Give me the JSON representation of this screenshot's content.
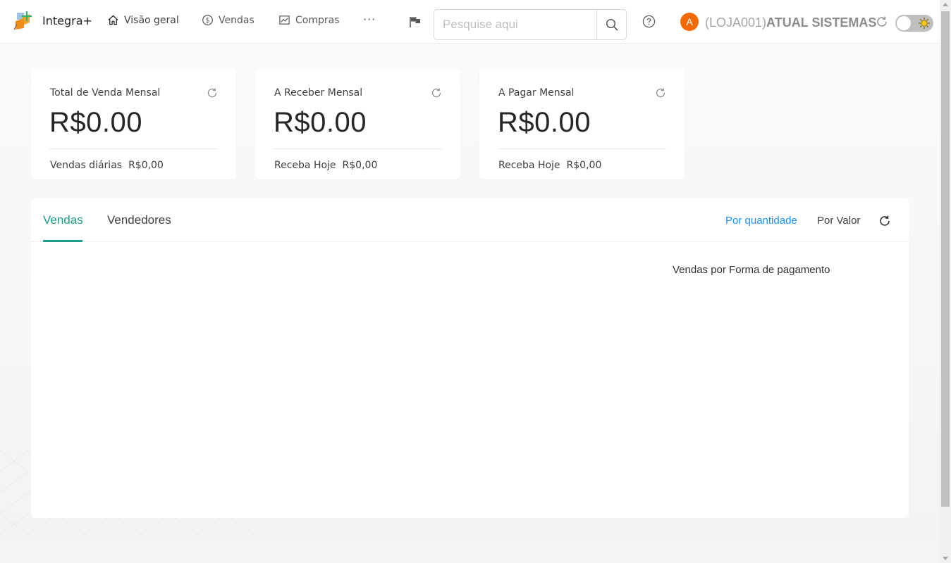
{
  "header": {
    "brand": "Integra+",
    "nav": [
      {
        "label": "Visão geral",
        "icon": "home-icon"
      },
      {
        "label": "Vendas",
        "icon": "dollar-circle-icon"
      },
      {
        "label": "Compras",
        "icon": "line-chart-icon"
      }
    ],
    "more": "···",
    "search": {
      "placeholder": "Pesquise aqui",
      "value": ""
    },
    "avatar_letter": "A",
    "store_code": "(LOJA001)",
    "company": "ATUAL SISTEMAS"
  },
  "cards": [
    {
      "title": "Total de Venda Mensal",
      "value": "R$0.00",
      "foot_label": "Vendas diárias",
      "foot_value": "R$0,00"
    },
    {
      "title": "A Receber Mensal",
      "value": "R$0.00",
      "foot_label": "Receba Hoje",
      "foot_value": "R$0,00"
    },
    {
      "title": "A Pagar Mensal",
      "value": "R$0.00",
      "foot_label": "Receba Hoje",
      "foot_value": "R$0,00"
    }
  ],
  "panel": {
    "tabs": [
      {
        "label": "Vendas",
        "active": true
      },
      {
        "label": "Vendedores",
        "active": false
      }
    ],
    "modes": [
      {
        "label": "Por quantidade",
        "active": true
      },
      {
        "label": "Por Valor",
        "active": false
      }
    ],
    "chart_title": "Vendas por Forma de pagamento"
  },
  "colors": {
    "accent": "#1b9e86",
    "link": "#1890ff",
    "avatar": "#f56a00"
  }
}
